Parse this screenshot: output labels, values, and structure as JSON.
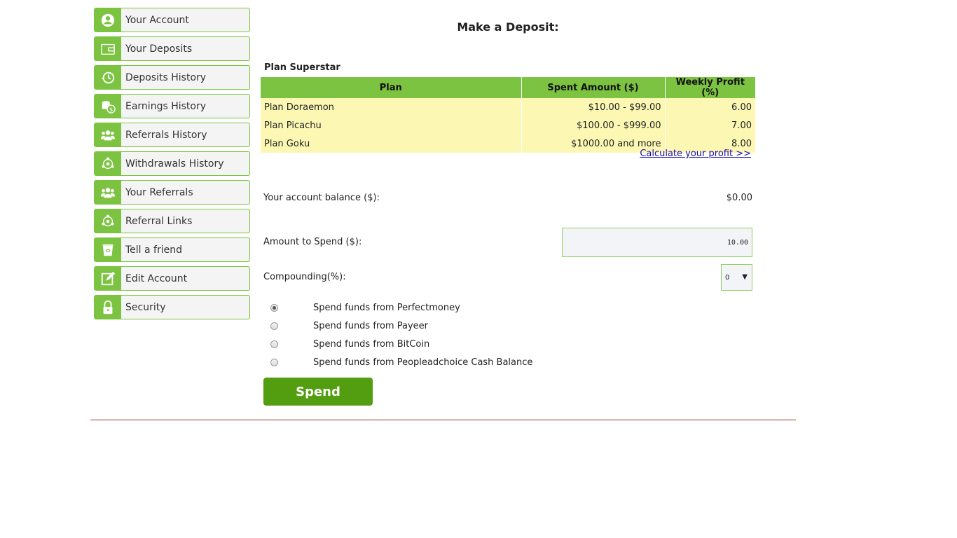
{
  "sidebar": {
    "items": [
      {
        "label": "Your Account",
        "icon": "user-circle-icon"
      },
      {
        "label": "Your Deposits",
        "icon": "wallet-icon"
      },
      {
        "label": "Deposits History",
        "icon": "history-clock-icon"
      },
      {
        "label": "Earnings History",
        "icon": "coins-dollar-icon"
      },
      {
        "label": "Referrals History",
        "icon": "people-group-icon"
      },
      {
        "label": "Withdrawals History",
        "icon": "network-people-icon"
      },
      {
        "label": "Your Referrals",
        "icon": "people-group-icon"
      },
      {
        "label": "Referral Links",
        "icon": "network-people-icon"
      },
      {
        "label": "Tell a friend",
        "icon": "cup-icon"
      },
      {
        "label": "Edit Account",
        "icon": "edit-pencil-icon"
      },
      {
        "label": "Security",
        "icon": "lock-icon"
      }
    ]
  },
  "main": {
    "title": "Make a Deposit:",
    "plan_name": "Plan Superstar",
    "table": {
      "headers": [
        "Plan",
        "Spent Amount ($)",
        "Weekly Profit (%)"
      ],
      "rows": [
        [
          "Plan Doraemon",
          "$10.00 - $99.00",
          "6.00"
        ],
        [
          "Plan Picachu",
          "$100.00 - $999.00",
          "7.00"
        ],
        [
          "Plan Goku",
          "$1000.00 and more",
          "8.00"
        ]
      ]
    },
    "calc_link": "Calculate your profit >>",
    "balance_label": "Your account balance ($):",
    "balance_value": "$0.00",
    "amount_label": "Amount to Spend ($):",
    "amount_value": "10.00",
    "compound_label": "Compounding(%):",
    "compound_value": "0",
    "payment_options": [
      {
        "label": "Spend funds from Perfectmoney",
        "checked": true
      },
      {
        "label": "Spend funds from Payeer",
        "checked": false
      },
      {
        "label": "Spend funds from BitCoin",
        "checked": false
      },
      {
        "label": "Spend funds from Peopleadchoice Cash Balance",
        "checked": false
      }
    ],
    "spend_button": "Spend"
  },
  "colors": {
    "accent_green": "#7cc341",
    "button_green": "#529e10",
    "table_row_bg": "#fcf8b4",
    "link": "#1a0dab"
  }
}
